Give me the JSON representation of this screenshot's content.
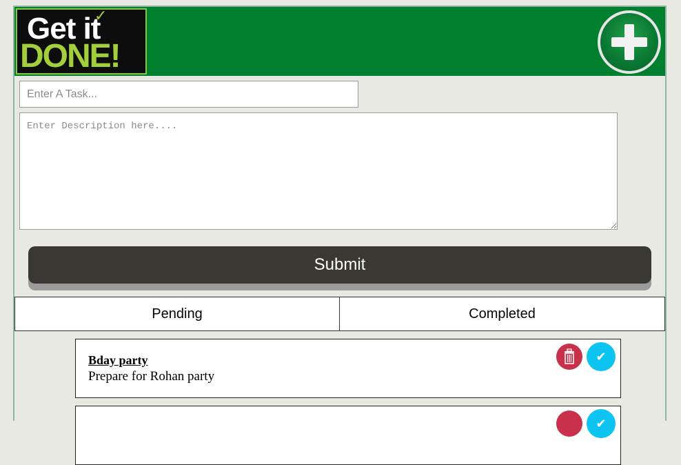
{
  "header": {
    "logo": {
      "line1": "Get it",
      "line2": "DONE!"
    },
    "add_icon": "plus-circle-icon"
  },
  "form": {
    "task_placeholder": "Enter A Task...",
    "description_placeholder": "Enter Description here....",
    "submit_label": "Submit"
  },
  "tabs": [
    {
      "label": "Pending"
    },
    {
      "label": "Completed"
    }
  ],
  "tasks": [
    {
      "title": "Bday party",
      "description": "Prepare for Rohan party",
      "delete_icon": "trash-icon",
      "complete_icon": "check-icon"
    },
    {
      "title": "",
      "description": "",
      "delete_icon": "trash-icon",
      "complete_icon": "check-icon"
    }
  ],
  "colors": {
    "header": "#00802e",
    "submit": "#3a3832",
    "delete": "#c9304a",
    "complete": "#0cc4ef",
    "logo_accent": "#a3cf3d"
  }
}
